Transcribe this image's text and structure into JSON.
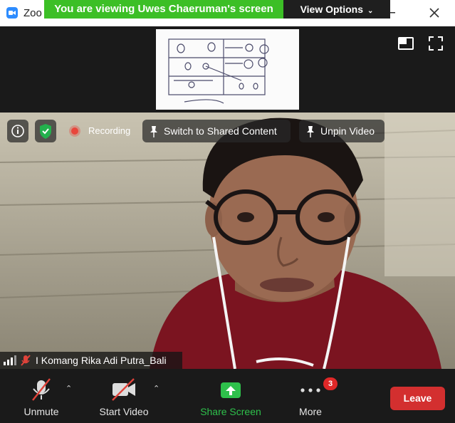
{
  "window": {
    "app_title": "Zoo"
  },
  "share_banner": {
    "text": "You are viewing Uwes Chaeruman's screen",
    "view_options_label": "View Options"
  },
  "overlay": {
    "recording_label": "Recording",
    "switch_label": "Switch to Shared Content",
    "unpin_label": "Unpin Video"
  },
  "participant": {
    "name": "I Komang Rika Adi Putra_Bali"
  },
  "toolbar": {
    "unmute_label": "Unmute",
    "start_video_label": "Start Video",
    "share_screen_label": "Share Screen",
    "more_label": "More",
    "more_badge": "3",
    "leave_label": "Leave"
  },
  "colors": {
    "banner_green": "#3cbf26",
    "share_green": "#2ec04b",
    "leave_red": "#d32f2f",
    "recording_red": "#e8463c",
    "badge_red": "#e02828",
    "zoom_blue": "#2d8cff"
  },
  "icons": [
    "zoom-app-icon",
    "minimize-icon",
    "close-icon",
    "chevron-down-icon",
    "speaker-view-icon",
    "fullscreen-icon",
    "info-icon",
    "shield-check-icon",
    "recording-dot-icon",
    "pin-icon",
    "signal-bars-icon",
    "muted-mic-icon",
    "mic-off-icon",
    "video-off-icon",
    "share-arrow-icon",
    "more-dots-icon"
  ]
}
